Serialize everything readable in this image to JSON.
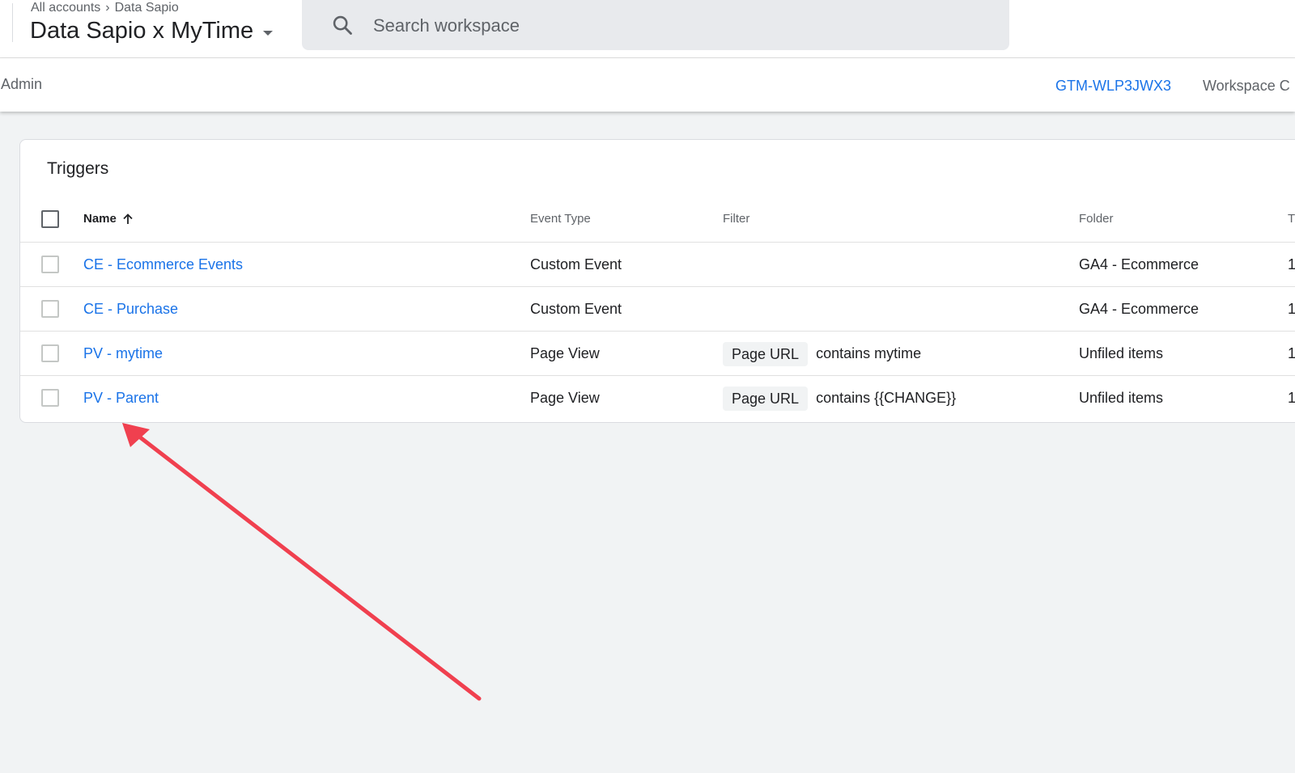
{
  "header": {
    "breadcrumb": [
      "All accounts",
      "Data Sapio"
    ],
    "container_name": "Data Sapio x MyTime",
    "search_placeholder": "Search workspace"
  },
  "subnav": {
    "admin": "Admin",
    "container_id": "GTM-WLP3JWX3",
    "workspace": "Workspace C"
  },
  "triggers": {
    "title": "Triggers",
    "columns": {
      "name": "Name",
      "event_type": "Event Type",
      "filter": "Filter",
      "folder": "Folder",
      "last": "T"
    },
    "rows": [
      {
        "name": "CE - Ecommerce Events",
        "event_type": "Custom Event",
        "filter_chip": "",
        "filter_text": "",
        "folder": "GA4 - Ecommerce",
        "last": "1"
      },
      {
        "name": "CE - Purchase",
        "event_type": "Custom Event",
        "filter_chip": "",
        "filter_text": "",
        "folder": "GA4 - Ecommerce",
        "last": "1"
      },
      {
        "name": "PV - mytime",
        "event_type": "Page View",
        "filter_chip": "Page URL",
        "filter_text": "contains mytime",
        "folder": "Unfiled items",
        "last": "1"
      },
      {
        "name": "PV - Parent",
        "event_type": "Page View",
        "filter_chip": "Page URL",
        "filter_text": "contains {{CHANGE}}",
        "folder": "Unfiled items",
        "last": "1"
      }
    ]
  },
  "colors": {
    "link": "#1a73e8",
    "annotation_arrow": "#f0404f",
    "page_bg": "#f1f3f4"
  }
}
